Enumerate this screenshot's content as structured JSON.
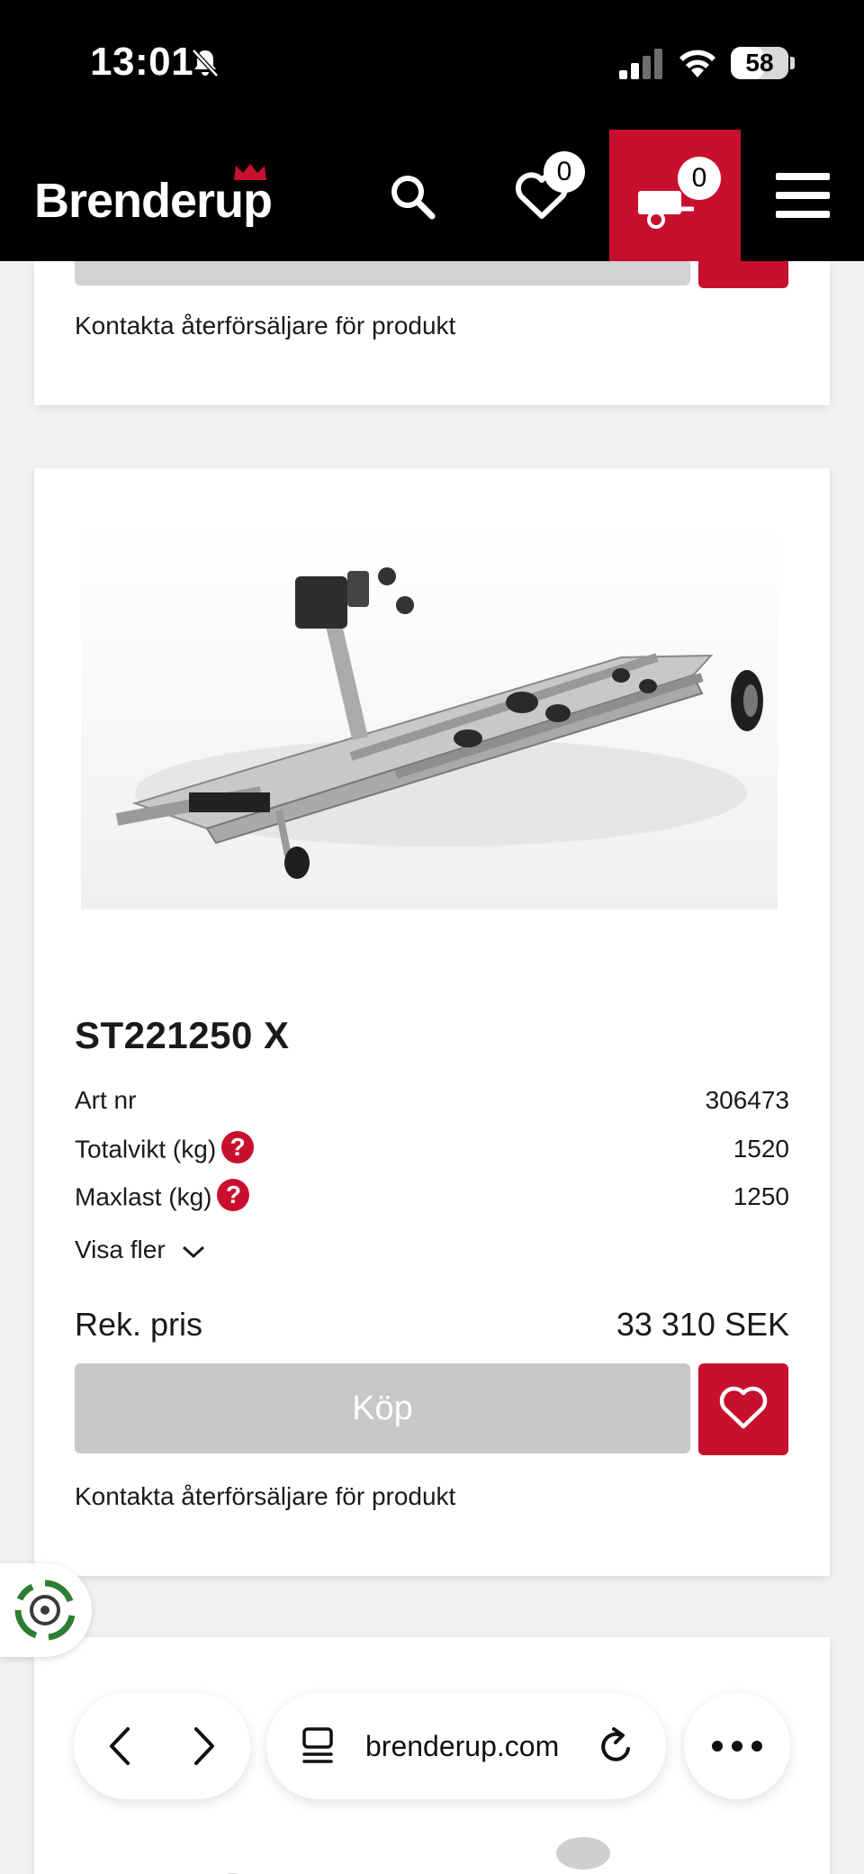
{
  "status_bar": {
    "time": "13:01",
    "battery": "58",
    "battery_level": 0.58,
    "icons": [
      "bell-slash-icon",
      "signal-icon",
      "wifi-icon",
      "battery-icon"
    ]
  },
  "header": {
    "logo": "Brenderup",
    "wishlist_count": "0",
    "cart_count": "0",
    "icons": [
      "search-icon",
      "heart-icon",
      "trailer-cart-icon",
      "hamburger-menu-icon"
    ],
    "colors": {
      "background": "#000000",
      "accent": "#c8102e"
    }
  },
  "card_top": {
    "contact_text": "Kontakta återförsäljare för produkt"
  },
  "product": {
    "image_alt": "Boat trailer",
    "title": "ST221250 X",
    "specs": [
      {
        "label": "Art nr",
        "value": "306473",
        "help": false
      },
      {
        "label": "Totalvikt (kg)",
        "value": "1520",
        "help": true
      },
      {
        "label": "Maxlast (kg)",
        "value": "1250",
        "help": true
      }
    ],
    "help_symbol": "?",
    "show_more": "Visa fler",
    "price_label": "Rek. pris",
    "price_value": "33 310 SEK",
    "buy_label": "Köp",
    "contact_text": "Kontakta återförsäljare för produkt"
  },
  "browser": {
    "url": "brenderup.com",
    "icons": [
      "back-icon",
      "forward-icon",
      "tabs-icon",
      "reload-icon",
      "more-icon"
    ]
  }
}
